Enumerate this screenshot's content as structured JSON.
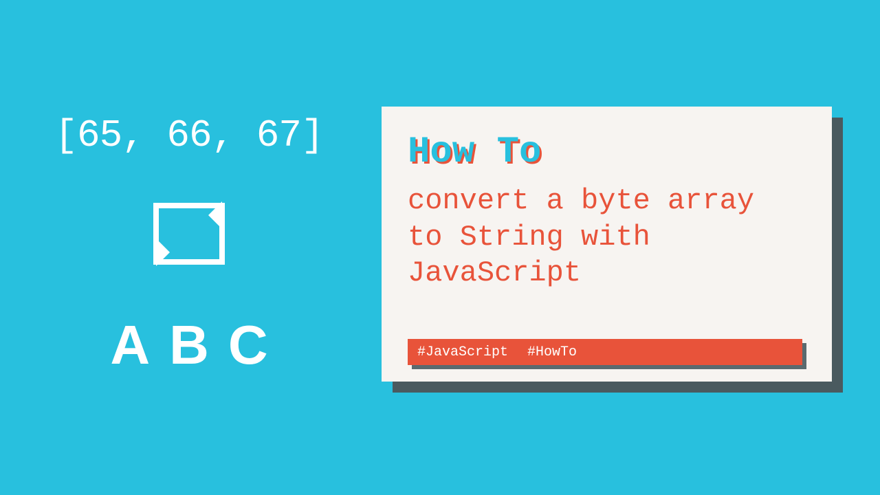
{
  "illustration": {
    "byte_array_text": "[65, 66, 67]",
    "result_text": "ABC"
  },
  "card": {
    "eyebrow": "How To",
    "title": "convert a byte array to String with JavaScript",
    "tags": [
      "#JavaScript",
      "#HowTo"
    ]
  },
  "colors": {
    "background": "#28c0de",
    "accent": "#e8533a",
    "card_bg": "#f7f4f1",
    "shadow": "#4a5a5f"
  }
}
